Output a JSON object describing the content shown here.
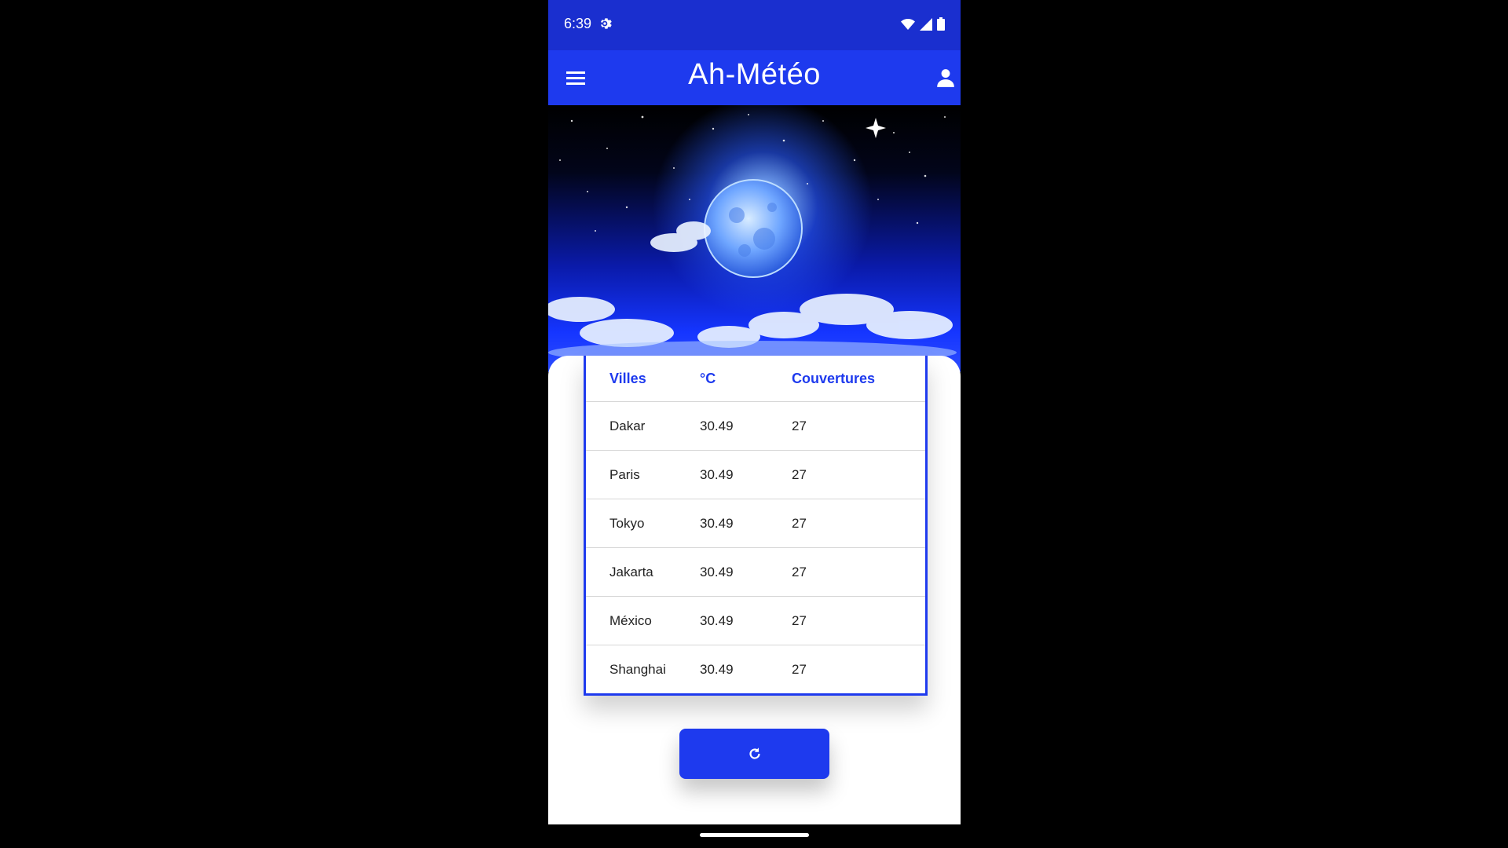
{
  "status": {
    "time": "6:39",
    "icons": [
      "gear-icon",
      "wifi-icon",
      "cell-signal-icon",
      "battery-icon"
    ]
  },
  "appbar": {
    "title": "Ah-Météo",
    "menu_icon": "hamburger-menu-icon",
    "account_icon": "user-icon"
  },
  "table": {
    "headers": [
      "Villes",
      "°C",
      "Couvertures"
    ],
    "rows": [
      {
        "city": "Dakar",
        "temp": "30.49",
        "cover": "27"
      },
      {
        "city": "Paris",
        "temp": "30.49",
        "cover": "27"
      },
      {
        "city": "Tokyo",
        "temp": "30.49",
        "cover": "27"
      },
      {
        "city": "Jakarta",
        "temp": "30.49",
        "cover": "27"
      },
      {
        "city": "México",
        "temp": "30.49",
        "cover": "27"
      },
      {
        "city": "Shanghai",
        "temp": "30.49",
        "cover": "27"
      }
    ]
  },
  "refresh_button": {
    "icon": "refresh-icon"
  },
  "colors": {
    "primary": "#1e3aee",
    "statusbar": "#1a2fcf",
    "background": "#000000"
  }
}
